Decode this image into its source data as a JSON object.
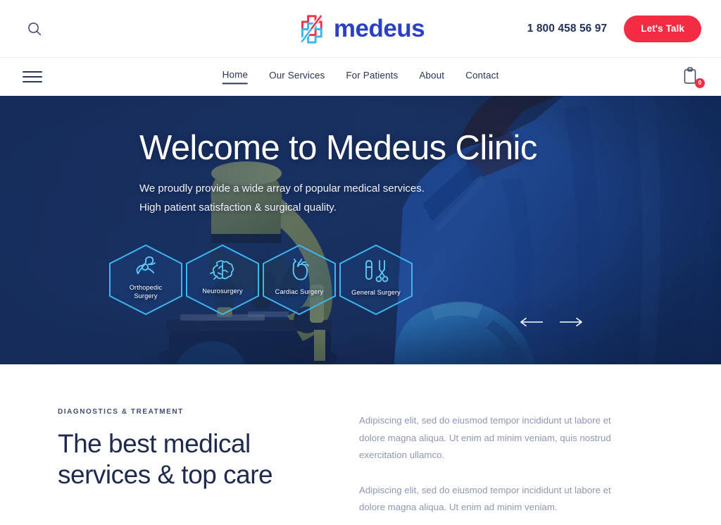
{
  "brand": {
    "word": "medeus",
    "mark_icon": "medical-cross-logo",
    "word_color": "#2b41c4",
    "cross_red": "#f4314a",
    "cross_blue": "#3cb6ef"
  },
  "topbar": {
    "search_icon": "search-icon",
    "phone": "1 800 458 56 97",
    "cta_label": "Let's Talk",
    "cta_color": "#f42c43"
  },
  "nav": {
    "menu_icon": "hamburger-menu-icon",
    "cart_icon": "clipboard-cart-icon",
    "cart_count": "0",
    "items": [
      {
        "label": "Home",
        "active": true
      },
      {
        "label": "Our Services",
        "active": false
      },
      {
        "label": "For Patients",
        "active": false
      },
      {
        "label": "About",
        "active": false
      },
      {
        "label": "Contact",
        "active": false
      }
    ]
  },
  "hero": {
    "title": "Welcome to Medeus Clinic",
    "subtitle_line1": "We proudly provide a wide array of popular medical services.",
    "subtitle_line2": "High patient satisfaction & surgical quality.",
    "background_color": "#1d3563",
    "accent_color": "#2fa8e8",
    "prev_icon": "arrow-left-icon",
    "next_icon": "arrow-right-icon",
    "services": [
      {
        "label_line1": "Orthopedic",
        "label_line2": "Surgery",
        "icon": "bone-joint-icon"
      },
      {
        "label_line1": "Neurosurgery",
        "label_line2": "",
        "icon": "brain-icon"
      },
      {
        "label_line1": "Cardiac Surgery",
        "label_line2": "",
        "icon": "heart-icon"
      },
      {
        "label_line1": "General Surgery",
        "label_line2": "",
        "icon": "scalpel-scissors-icon"
      }
    ]
  },
  "section": {
    "eyebrow": "DIAGNOSTICS & TREATMENT",
    "title_line1": "The best medical",
    "title_line2": "services & top care",
    "paragraph1": "Adipiscing elit, sed do eiusmod tempor incididunt ut labore et dolore magna aliqua. Ut enim ad minim veniam, quis nostrud exercitation ullamco.",
    "paragraph2": "Adipiscing elit, sed do eiusmod tempor incididunt ut labore et dolore magna aliqua. Ut enim ad minim veniam."
  }
}
